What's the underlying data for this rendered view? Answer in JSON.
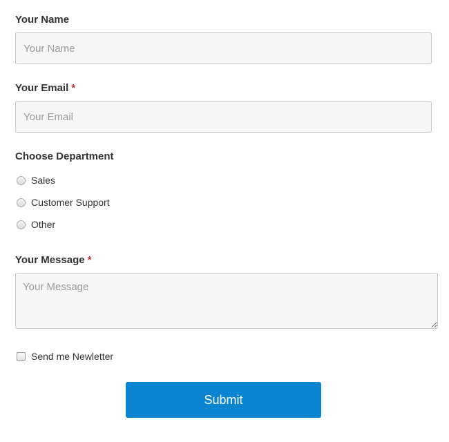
{
  "form": {
    "name": {
      "label": "Your Name",
      "placeholder": "Your Name",
      "value": ""
    },
    "email": {
      "label": "Your Email",
      "required_mark": "*",
      "placeholder": "Your Email",
      "value": ""
    },
    "department": {
      "label": "Choose Department",
      "options": [
        "Sales",
        "Customer Support",
        "Other"
      ],
      "selected": null
    },
    "message": {
      "label": "Your Message",
      "required_mark": "*",
      "placeholder": "Your Message",
      "value": ""
    },
    "newsletter": {
      "label": "Send me Newletter",
      "checked": false
    },
    "submit_label": "Submit"
  },
  "colors": {
    "submit_bg": "#0b84d1",
    "required_mark": "#b83232",
    "input_bg": "#f6f6f6",
    "input_border": "#c4c4c4"
  }
}
